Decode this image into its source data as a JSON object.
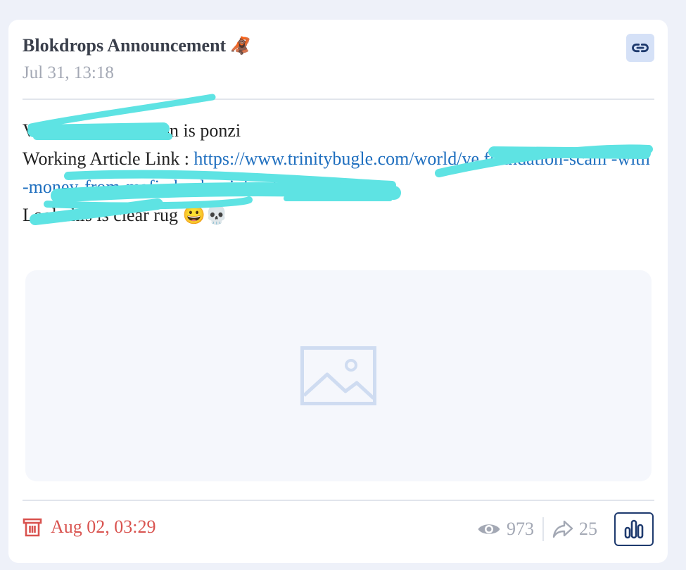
{
  "post": {
    "channel_title": "Blokdrops Announcement",
    "channel_emoji": "🦧",
    "date": "Jul 31, 13:18",
    "line1_prefix": "V",
    "line1_suffix": "ion is ponzi",
    "article_label": "Working Article Link : ",
    "article_link_visible": "https://www.trinitybugle.com/world/ve      foundation-scam                                      -with-money-from-mafia-banker-i          .html",
    "closing_text": "Look this is clear rug 😀💀"
  },
  "footer": {
    "deleted_date": "Aug 02, 03:29",
    "views": "973",
    "shares": "25"
  },
  "colors": {
    "redaction": "#5ee3e3",
    "link": "#1f6fbf",
    "deleted": "#d9534f",
    "muted": "#a3a8b4",
    "stats_border": "#1e3a6e"
  },
  "icons": {
    "link": "link-icon",
    "image": "image-placeholder-icon",
    "deleted": "trash-icon",
    "views": "eye-icon",
    "shares": "share-arrow-icon",
    "stats": "bar-chart-icon"
  }
}
